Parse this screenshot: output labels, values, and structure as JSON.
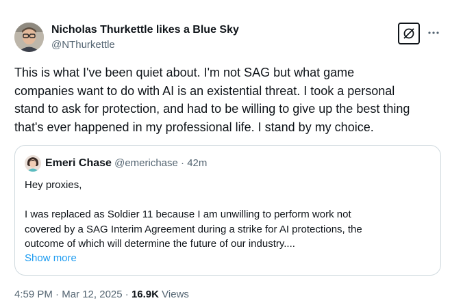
{
  "author": {
    "name": "Nicholas Thurkettle likes a Blue Sky",
    "handle": "@NThurkettle"
  },
  "tweet_lines": [
    "This is what I've been quiet about. I'm not SAG but what game",
    "companies want to do with AI is an existential threat. I took a personal",
    "stand to ask for protection, and had to be willing to give up the best thing",
    "that's ever happened in my professional life. I stand by my choice."
  ],
  "quote": {
    "name": "Emeri Chase",
    "handle": "@emerichase",
    "separator": "·",
    "time": "42m",
    "lines": [
      "Hey proxies,",
      "",
      "I was replaced as Soldier 11 because I am unwilling to perform work not",
      "covered by a SAG Interim Agreement during a strike for AI protections, the",
      "outcome of which will determine the future of our industry...."
    ],
    "show_more": "Show more"
  },
  "footer": {
    "time": "4:59 PM",
    "sep1": "·",
    "date": "Mar 12, 2025",
    "sep2": "·",
    "views_count": "16.9K",
    "views_label": "Views"
  },
  "icons": {
    "grok": "grok-icon",
    "more": "more-icon"
  },
  "colors": {
    "text": "#0f1419",
    "secondary": "#536471",
    "link": "#1d9bf0",
    "border": "#cfd9de"
  }
}
